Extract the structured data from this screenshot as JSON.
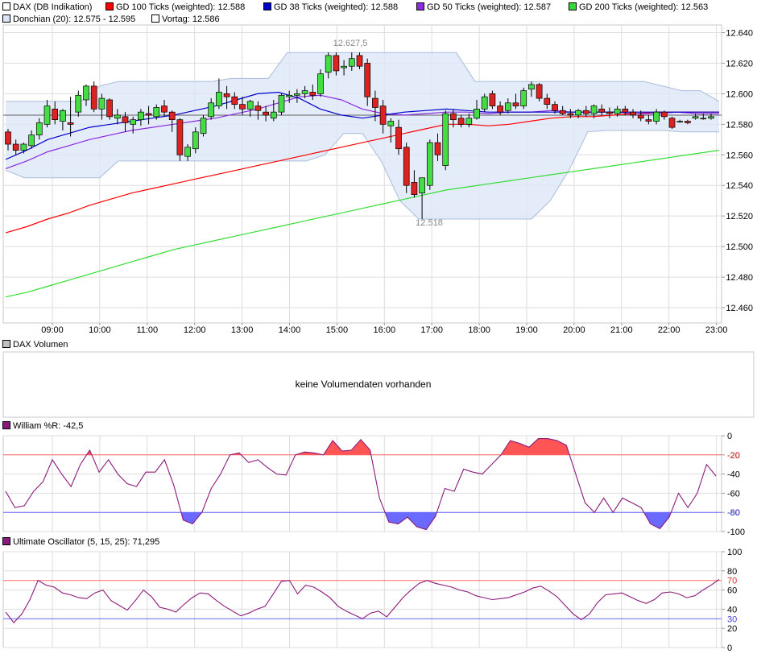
{
  "colors": {
    "price_sw": "#ffffff",
    "gd100": "#ff0000",
    "gd38": "#0000cc",
    "gd50": "#8a2be2",
    "gd200": "#33dd33",
    "donchian_fill": "#dde6f8",
    "donchian_line": "#a8bcd9",
    "vortag": "#606060",
    "up": "#44dd44",
    "down": "#dd2222",
    "williams_line": "#8b1a7a",
    "williams_fill_hi": "#ff5555",
    "williams_fill_lo": "#6a6aff",
    "ref_high": "#ff6666",
    "ref_low": "#6666ff",
    "grid": "#dddddd",
    "frame": "#c8c8c8"
  },
  "legend": {
    "dax": "DAX (DB Indikation)",
    "gd100": "GD 100 Ticks (weighted): 12.588",
    "gd38": "GD 38 Ticks (weighted): 12.588",
    "gd50": "GD 50 Ticks (weighted): 12.587",
    "gd200": "GD 200 Ticks (weighted): 12.563",
    "donchian": "Donchian (20): 12.575 - 12.595",
    "vortag": "Vortag: 12.586"
  },
  "volume": {
    "title": "DAX Volumen",
    "message": "keine Volumendaten vorhanden"
  },
  "williams": {
    "title": "William %R: -42,5",
    "ticks": [
      "0",
      "-20",
      "-40",
      "-60",
      "-80",
      "-100"
    ],
    "ref_high_label": "-20",
    "ref_low_label": "-80"
  },
  "ultimate": {
    "title": "Ultimate Oscillator (5, 15, 25): 71,295",
    "ticks": [
      "100",
      "80",
      "60",
      "40",
      "20",
      "0"
    ],
    "ref_high_label": "70",
    "ref_low_label": "30"
  },
  "chart_data": [
    {
      "type": "candlestick",
      "title": "DAX (DB Indikation)",
      "y_ticks": [
        "12.640",
        "12.620",
        "12.600",
        "12.580",
        "12.560",
        "12.540",
        "12.520",
        "12.500",
        "12.480",
        "12.460"
      ],
      "ylim": [
        12450,
        12645
      ],
      "x_ticks": [
        "09:00",
        "10:00",
        "11:00",
        "12:00",
        "13:00",
        "14:00",
        "15:00",
        "16:00",
        "17:00",
        "18:00",
        "19:00",
        "20:00",
        "21:00",
        "22:00",
        "23:00"
      ],
      "annotations": {
        "high": "12.627,5",
        "low": "12.518"
      },
      "vortag": 12586,
      "candles": [
        [
          12575,
          12577,
          12563,
          12567
        ],
        [
          12567,
          12570,
          12560,
          12563
        ],
        [
          12563,
          12568,
          12561,
          12567
        ],
        [
          12566,
          12576,
          12564,
          12573
        ],
        [
          12573,
          12584,
          12570,
          12581
        ],
        [
          12580,
          12596,
          12578,
          12592
        ],
        [
          12590,
          12595,
          12580,
          12583
        ],
        [
          12582,
          12590,
          12576,
          12589
        ],
        [
          12581,
          12598,
          12572,
          12580
        ],
        [
          12588,
          12602,
          12585,
          12599
        ],
        [
          12596,
          12606,
          12592,
          12605
        ],
        [
          12605,
          12608,
          12588,
          12590
        ],
        [
          12590,
          12600,
          12583,
          12597
        ],
        [
          12596,
          12597,
          12583,
          12585
        ],
        [
          12584,
          12590,
          12580,
          12586
        ],
        [
          12585,
          12588,
          12575,
          12581
        ],
        [
          12580,
          12585,
          12574,
          12583
        ],
        [
          12583,
          12590,
          12579,
          12588
        ],
        [
          12587,
          12592,
          12580,
          12586
        ],
        [
          12585,
          12593,
          12583,
          12591
        ],
        [
          12592,
          12596,
          12585,
          12588
        ],
        [
          12588,
          12589,
          12575,
          12583
        ],
        [
          12583,
          12584,
          12556,
          12560
        ],
        [
          12559,
          12567,
          12556,
          12565
        ],
        [
          12564,
          12578,
          12561,
          12575
        ],
        [
          12574,
          12586,
          12572,
          12584
        ],
        [
          12585,
          12597,
          12583,
          12594
        ],
        [
          12592,
          12610,
          12590,
          12601
        ],
        [
          12600,
          12605,
          12590,
          12598
        ],
        [
          12598,
          12601,
          12590,
          12593
        ],
        [
          12593,
          12598,
          12586,
          12590
        ],
        [
          12590,
          12596,
          12585,
          12595
        ],
        [
          12592,
          12595,
          12583,
          12589
        ],
        [
          12588,
          12592,
          12582,
          12586
        ],
        [
          12584,
          12596,
          12582,
          12588
        ],
        [
          12588,
          12600,
          12586,
          12599
        ],
        [
          12598,
          12602,
          12594,
          12599
        ],
        [
          12599,
          12603,
          12594,
          12600
        ],
        [
          12600,
          12605,
          12597,
          12602
        ],
        [
          12601,
          12606,
          12596,
          12599
        ],
        [
          12600,
          12616,
          12598,
          12613
        ],
        [
          12614,
          12627,
          12610,
          12625
        ],
        [
          12625,
          12627,
          12612,
          12615
        ],
        [
          12617,
          12622,
          12612,
          12618
        ],
        [
          12618,
          12627,
          12615,
          12623
        ],
        [
          12625,
          12627,
          12616,
          12618
        ],
        [
          12620,
          12623,
          12592,
          12598
        ],
        [
          12597,
          12602,
          12582,
          12591
        ],
        [
          12592,
          12596,
          12574,
          12580
        ],
        [
          12579,
          12584,
          12568,
          12582
        ],
        [
          12578,
          12583,
          12560,
          12564
        ],
        [
          12565,
          12568,
          12535,
          12540
        ],
        [
          12542,
          12550,
          12532,
          12534
        ],
        [
          12535,
          12545,
          12518,
          12545
        ],
        [
          12540,
          12570,
          12537,
          12568
        ],
        [
          12568,
          12574,
          12556,
          12560
        ],
        [
          12553,
          12589,
          12550,
          12587
        ],
        [
          12587,
          12590,
          12578,
          12583
        ],
        [
          12584,
          12586,
          12578,
          12580
        ],
        [
          12580,
          12587,
          12578,
          12584
        ],
        [
          12584,
          12596,
          12583,
          12590
        ],
        [
          12590,
          12600,
          12588,
          12598
        ],
        [
          12600,
          12602,
          12590,
          12592
        ],
        [
          12592,
          12595,
          12586,
          12588
        ],
        [
          12589,
          12597,
          12587,
          12594
        ],
        [
          12594,
          12600,
          12590,
          12592
        ],
        [
          12592,
          12604,
          12590,
          12602
        ],
        [
          12603,
          12608,
          12598,
          12606
        ],
        [
          12606,
          12607,
          12595,
          12597
        ],
        [
          12597,
          12600,
          12590,
          12593
        ],
        [
          12593,
          12595,
          12587,
          12589
        ],
        [
          12589,
          12592,
          12586,
          12587
        ],
        [
          12587,
          12590,
          12584,
          12586
        ],
        [
          12586,
          12590,
          12584,
          12589
        ],
        [
          12589,
          12592,
          12585,
          12587
        ],
        [
          12587,
          12593,
          12584,
          12592
        ],
        [
          12590,
          12593,
          12586,
          12588
        ],
        [
          12588,
          12591,
          12584,
          12587
        ],
        [
          12587,
          12592,
          12585,
          12590
        ],
        [
          12590,
          12592,
          12586,
          12588
        ],
        [
          12588,
          12590,
          12584,
          12586
        ],
        [
          12586,
          12589,
          12582,
          12584
        ],
        [
          12583,
          12586,
          12580,
          12582
        ],
        [
          12582,
          12590,
          12580,
          12588
        ],
        [
          12588,
          12589,
          12583,
          12585
        ],
        [
          12584,
          12585,
          12577,
          12578
        ],
        [
          12582,
          12583,
          12581,
          12582
        ],
        [
          12582,
          12583,
          12580,
          12581
        ],
        [
          12584,
          12587,
          12583,
          12585
        ],
        [
          12584,
          12587,
          12583,
          12584
        ],
        [
          12584,
          12587,
          12583,
          12585
        ]
      ],
      "series": [
        {
          "name": "GD 200 Ticks (weighted): 12.563",
          "values": [
            12467,
            12470,
            12474,
            12478,
            12482,
            12486,
            12490,
            12494,
            12498,
            12501,
            12504,
            12507,
            12510,
            12513,
            12516,
            12519,
            12522,
            12525,
            12528,
            12531,
            12534,
            12537,
            12539,
            12541,
            12543,
            12545,
            12547,
            12549,
            12551,
            12553,
            12555,
            12557,
            12559,
            12561,
            12563
          ]
        },
        {
          "name": "GD 100 Ticks (weighted): 12.588",
          "values": [
            12509,
            12513,
            12518,
            12522,
            12527,
            12531,
            12535,
            12538,
            12541,
            12544,
            12547,
            12550,
            12553,
            12556,
            12559,
            12562,
            12565,
            12568,
            12571,
            12574,
            12577,
            12580,
            12580,
            12579,
            12580,
            12582,
            12584,
            12585,
            12585,
            12586,
            12587,
            12588,
            12588,
            12588,
            12588
          ]
        },
        {
          "name": "GD 50 Ticks (weighted): 12.587",
          "values": [
            12551,
            12556,
            12562,
            12566,
            12570,
            12573,
            12576,
            12578,
            12580,
            12582,
            12584,
            12587,
            12590,
            12594,
            12598,
            12599,
            12596,
            12590,
            12587,
            12586,
            12587,
            12588,
            12588,
            12587,
            12588,
            12588,
            12589,
            12588,
            12588,
            12588,
            12587,
            12587,
            12588,
            12587,
            12587
          ]
        },
        {
          "name": "GD 38 Ticks (weighted): 12.588",
          "values": [
            12557,
            12563,
            12570,
            12574,
            12578,
            12580,
            12582,
            12584,
            12586,
            12589,
            12592,
            12596,
            12600,
            12601,
            12597,
            12590,
            12586,
            12584,
            12586,
            12588,
            12589,
            12590,
            12589,
            12588,
            12588,
            12588,
            12588,
            12588,
            12588,
            12588,
            12588,
            12588,
            12588,
            12588,
            12588
          ]
        },
        {
          "name": "Donchian (20): 12.575 - 12.595",
          "upper": [
            12595,
            12595,
            12595,
            12595,
            12595,
            12605,
            12608,
            12608,
            12608,
            12608,
            12608,
            12608,
            12610,
            12610,
            12610,
            12627,
            12627,
            12627,
            12627,
            12627,
            12627,
            12627,
            12627,
            12627,
            12627,
            12608,
            12608,
            12608,
            12608,
            12608,
            12608,
            12608,
            12608,
            12608,
            12608,
            12605,
            12602,
            12602,
            12595
          ],
          "lower": [
            12550,
            12545,
            12545,
            12545,
            12545,
            12545,
            12556,
            12556,
            12556,
            12556,
            12556,
            12556,
            12556,
            12556,
            12556,
            12556,
            12556,
            12560,
            12574,
            12574,
            12556,
            12530,
            12518,
            12518,
            12518,
            12518,
            12518,
            12518,
            12518,
            12530,
            12550,
            12575,
            12576,
            12576,
            12576,
            12576,
            12575,
            12575,
            12575
          ]
        }
      ]
    },
    {
      "type": "line",
      "title": "William %R: -42,5",
      "ylim": [
        -100,
        0
      ],
      "reference_lines": [
        -20,
        -80
      ],
      "values": [
        -58,
        -75,
        -73,
        -58,
        -48,
        -25,
        -40,
        -53,
        -30,
        -15,
        -38,
        -25,
        -40,
        -50,
        -53,
        -38,
        -38,
        -25,
        -52,
        -88,
        -92,
        -80,
        -55,
        -40,
        -20,
        -18,
        -28,
        -25,
        -33,
        -40,
        -41,
        -20,
        -17,
        -18,
        -20,
        -5,
        -16,
        -15,
        -4,
        -15,
        -65,
        -90,
        -92,
        -85,
        -95,
        -98,
        -84,
        -55,
        -58,
        -35,
        -38,
        -40,
        -30,
        -20,
        -5,
        -8,
        -12,
        -3,
        -3,
        -5,
        -10,
        -40,
        -70,
        -80,
        -65,
        -80,
        -65,
        -70,
        -75,
        -92,
        -97,
        -85,
        -60,
        -75,
        -60,
        -30,
        -42
      ]
    },
    {
      "type": "line",
      "title": "Ultimate Oscillator (5, 15, 25): 71,295",
      "ylim": [
        0,
        100
      ],
      "reference_lines": [
        70,
        30
      ],
      "values": [
        37,
        26,
        35,
        50,
        70,
        65,
        63,
        57,
        55,
        52,
        51,
        57,
        60,
        49,
        44,
        39,
        49,
        60,
        53,
        42,
        40,
        37,
        45,
        52,
        57,
        56,
        49,
        43,
        38,
        33,
        36,
        40,
        43,
        56,
        69,
        70,
        56,
        65,
        63,
        58,
        52,
        43,
        38,
        34,
        30,
        36,
        38,
        32,
        42,
        52,
        60,
        67,
        70,
        67,
        65,
        63,
        60,
        58,
        54,
        52,
        50,
        51,
        52,
        55,
        58,
        62,
        64,
        59,
        53,
        44,
        35,
        29,
        35,
        47,
        55,
        56,
        57,
        53,
        49,
        46,
        50,
        57,
        58,
        56,
        52,
        54,
        60,
        65,
        71
      ]
    }
  ]
}
